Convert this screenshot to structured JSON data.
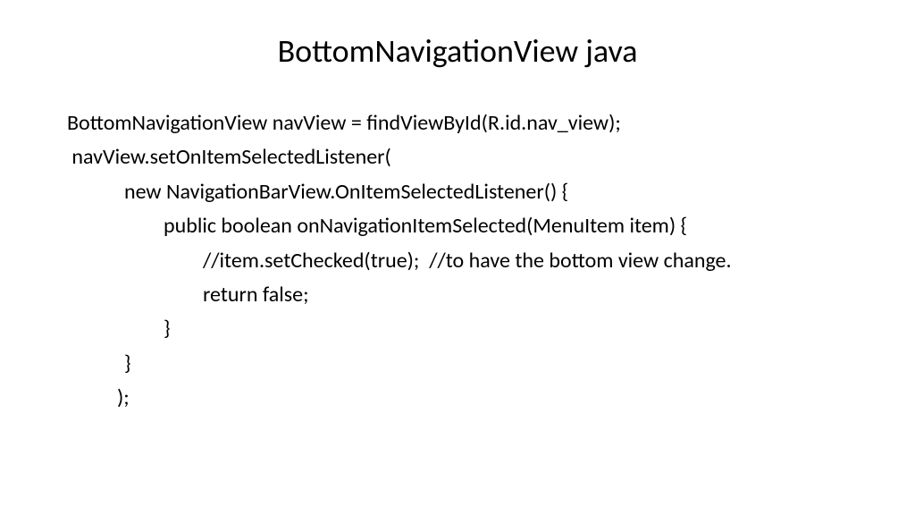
{
  "title": "BottomNavigationView java",
  "code": {
    "line1": "BottomNavigationView navView = findViewById(R.id.nav_view);",
    "line2": " navView.setOnItemSelectedListener(",
    "line3": "new NavigationBarView.OnItemSelectedListener() {",
    "line4": "public boolean onNavigationItemSelected(MenuItem item) {",
    "line5": "//item.setChecked(true);  //to have the bottom view change.",
    "line6": "return false;",
    "line7": "}",
    "line8": "}",
    "line9": ");"
  }
}
